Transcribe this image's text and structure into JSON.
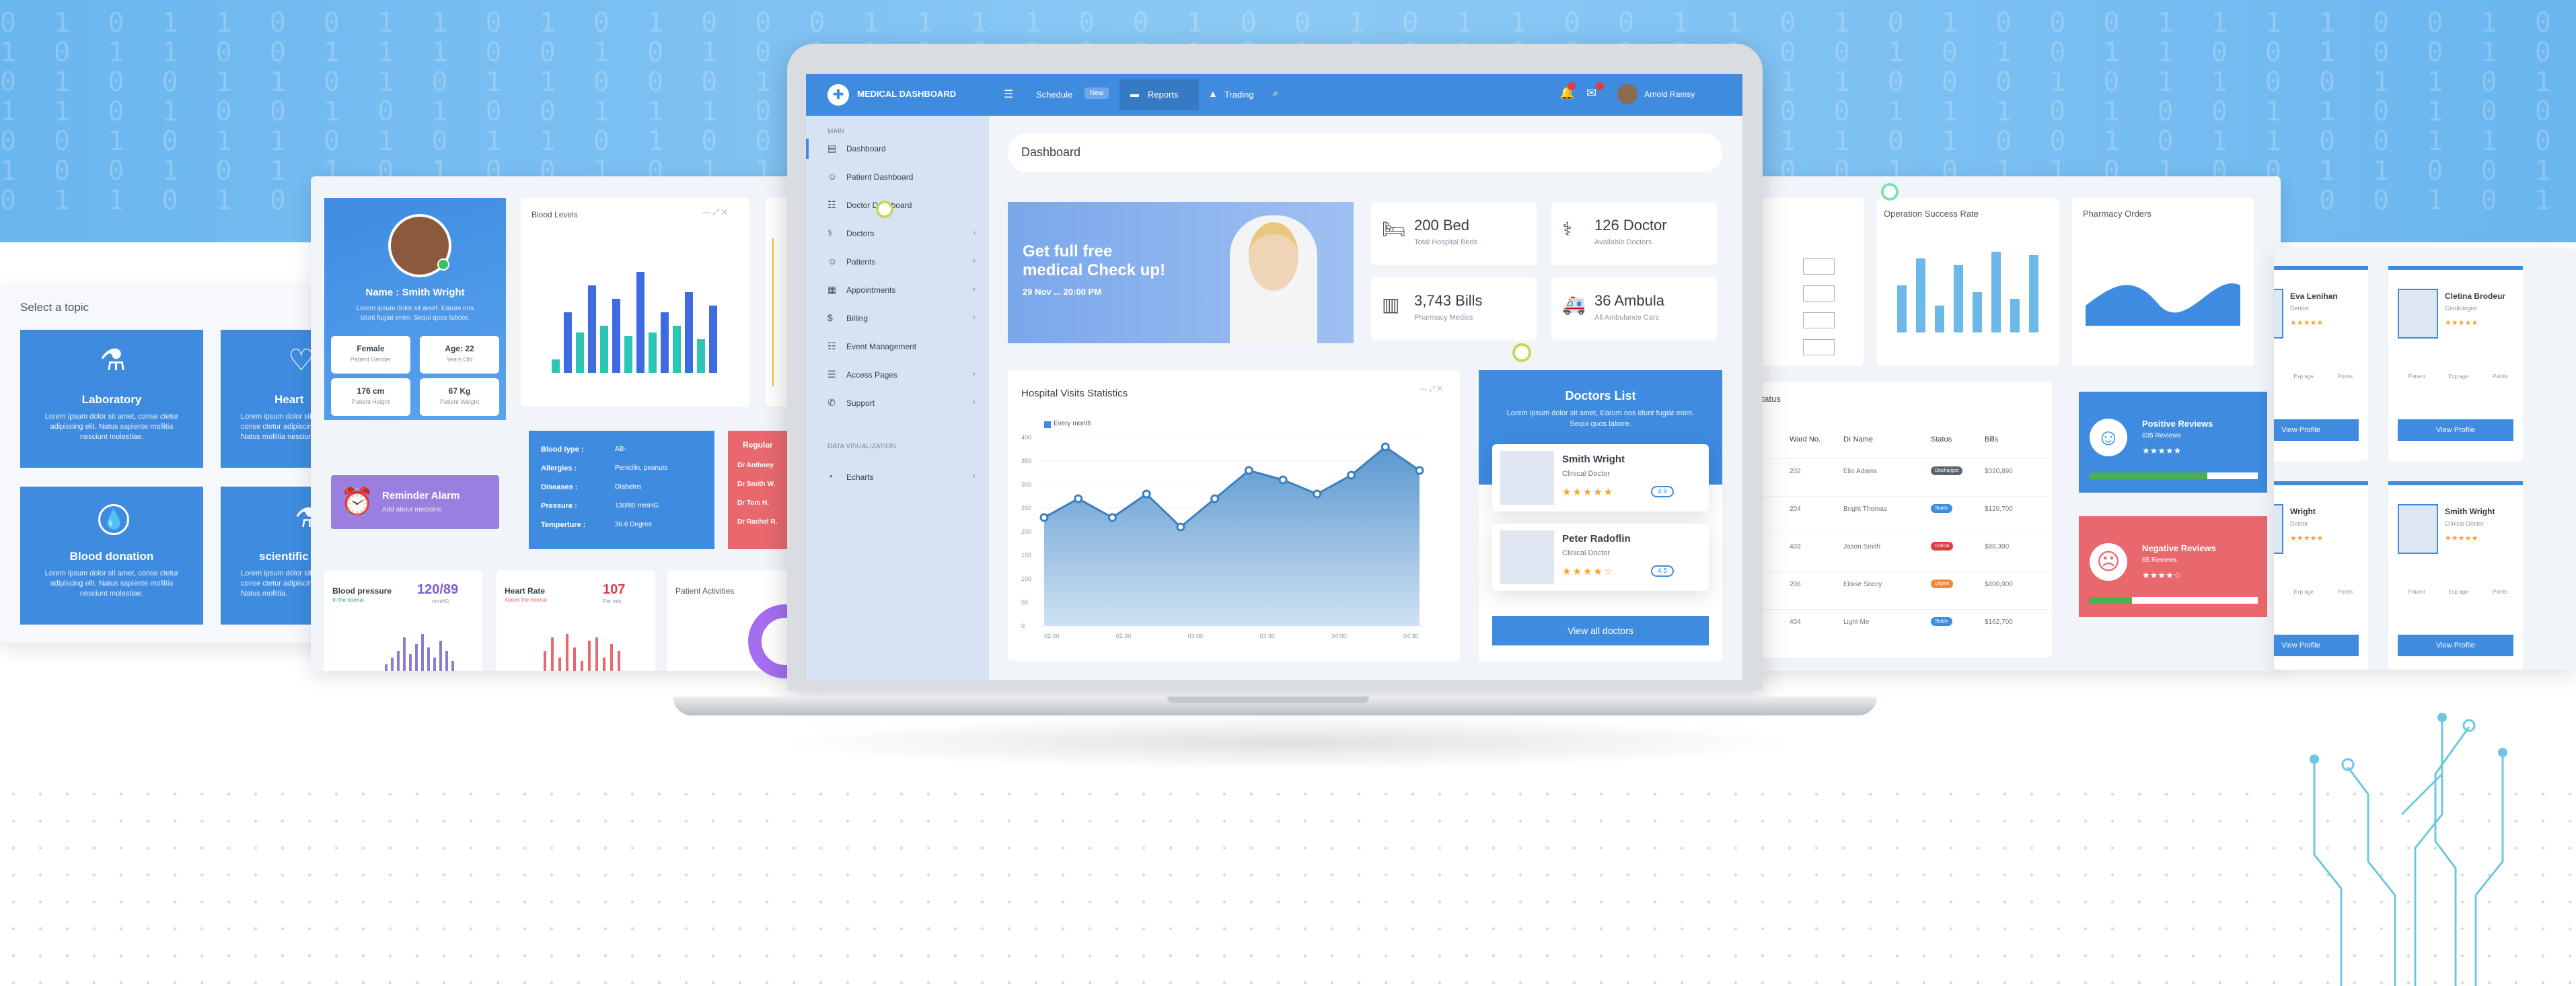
{
  "app": {
    "title": "MEDICAL DASHBOARD"
  },
  "topnav": {
    "schedule": "Schedule",
    "schedule_badge": "New",
    "reports": "Reports",
    "trading": "Trading",
    "user": "Arnold Ramsy"
  },
  "sidebar": {
    "section_main": "MAIN",
    "items": [
      {
        "label": "Dashboard"
      },
      {
        "label": "Patient Dashboard"
      },
      {
        "label": "Doctor Dashboard"
      },
      {
        "label": "Doctors"
      },
      {
        "label": "Patients"
      },
      {
        "label": "Appointments"
      },
      {
        "label": "Billing"
      },
      {
        "label": "Event Management"
      },
      {
        "label": "Access Pages"
      },
      {
        "label": "Support"
      }
    ],
    "section_data": "DATA VISUALIZATION",
    "data_items": [
      {
        "label": "Echarts"
      }
    ]
  },
  "page": {
    "title": "Dashboard"
  },
  "promo": {
    "title_1": "Get full free",
    "title_2": "medical Check up!",
    "date": "29 Nov ... 20:00 PM"
  },
  "stats": [
    {
      "value": "200 Bed",
      "label": "Total Hospital Beds",
      "icon": "bed-icon"
    },
    {
      "value": "126 Doctor",
      "label": "Available Doctors",
      "icon": "doctor-icon"
    },
    {
      "value": "3,743 Bills",
      "label": "Pharmacy Medics",
      "icon": "bill-icon"
    },
    {
      "value": "36 Ambula",
      "label": "All Ambulance Cars",
      "icon": "ambulance-icon"
    }
  ],
  "visits": {
    "title": "Hospital Visits Statistics",
    "legend": "Every month"
  },
  "chart_data": {
    "type": "area",
    "title": "Hospital Visits Statistics",
    "x": [
      "02:00",
      "02:30",
      "03:00",
      "03:30",
      "04:00",
      "04:30"
    ],
    "series": [
      {
        "name": "Every month",
        "values": [
          230,
          270,
          230,
          280,
          210,
          270,
          330,
          310,
          280,
          320,
          380,
          330
        ]
      }
    ],
    "y_ticks": [
      "400",
      "350",
      "300",
      "250",
      "200",
      "150",
      "100",
      "50",
      "0"
    ],
    "ylim": [
      0,
      400
    ]
  },
  "doctors_list": {
    "title": "Doctors List",
    "subtitle": "Lorem ipsum dolor sit amet, Earum nos idunt fugiat enim. Sequi quos labore.",
    "doctors": [
      {
        "name": "Smith Wright",
        "role": "Clinical Doctor",
        "stars": "★★★★★",
        "rating": "4.9"
      },
      {
        "name": "Peter Radoflin",
        "role": "Clinical Doctor",
        "stars": "★★★★☆",
        "rating": "4.5"
      }
    ],
    "button": "View all doctors"
  },
  "left_panel": {
    "topic": "Select a topic",
    "tiles": [
      {
        "title": "Laboratory",
        "text": "Lorem ipsum dolor sit amet, conse ctetur adipiscing elit. Natus sapiente mollitia nesciunt molestiae."
      },
      {
        "title": "Heart",
        "text": "Lorem ipsum dolor sit amet, conse ctetur adipiscing elit. Natus mollitia nesciunt."
      },
      {
        "title": "Blood donation",
        "text": "Lorem ipsum dolor sit amet, conse ctetur adipiscing elit. Natus sapiente mollitia nesciunt molestiae."
      },
      {
        "title": "scientific",
        "text": "Lorem ipsum dolor sit amet, conse ctetur adipiscing elit. Natus mollitia."
      }
    ]
  },
  "patient": {
    "name": "Name : Smith Wright",
    "desc": "Lorem ipsum dolor sit amet. Earum nos idunt fugiat enim. Sequi quos labore.",
    "gender": "Female",
    "gender_label": "Patient Gender",
    "age": "Age: 22",
    "age_label": "Years Old",
    "height": "176 cm",
    "height_label": "Patient Height",
    "weight": "67 Kg",
    "weight_label": "Patient Weight",
    "reminder": "Reminder Alarm",
    "reminder_sub": "Add about medicine",
    "blood_levels": "Blood Levels",
    "info_rows": [
      {
        "k": "Blood type :",
        "v": "AB-"
      },
      {
        "k": "Allergies :",
        "v": "Penicilin, peanuts"
      },
      {
        "k": "Diseases :",
        "v": "Diabetes"
      },
      {
        "k": "Pressure :",
        "v": "130/80 mmHG"
      },
      {
        "k": "Temperture :",
        "v": "36.6 Degree"
      }
    ],
    "regular": "Regular",
    "regular_rows": [
      "Dr Anthony",
      "Dr Smith W.",
      "Dr Tom H.",
      "Dr Rachel R."
    ],
    "bp_label": "Blood pressure",
    "bp_value": "120/89",
    "bp_sub": "In the normal",
    "bp_unit": "mmHG",
    "hr_label": "Heart Rate",
    "hr_value": "107",
    "hr_sub": "Above the normal",
    "hr_unit": "Per min",
    "activities": "Patient Activities"
  },
  "right_panel": {
    "op_title": "Operation Success Rate",
    "pharmacy_title": "Pharmacy Orders",
    "status_title": "Status",
    "table_headers": [
      "Ward No.",
      "Dr Name",
      "Status",
      "Bills"
    ],
    "rows": [
      {
        "ward": "202",
        "dr": "Elio Adams",
        "status": "Discharged",
        "bill": "$320,890"
      },
      {
        "ward": "204",
        "dr": "Bright Thomas",
        "status": "Stable",
        "bill": "$120,700"
      },
      {
        "ward": "403",
        "dr": "Jason Smith",
        "status": "Critical",
        "bill": "$88,300"
      },
      {
        "ward": "206",
        "dr": "Eloise Soccy",
        "status": "Urgent",
        "bill": "$400,000"
      },
      {
        "ward": "404",
        "dr": "Light Me",
        "status": "Stable",
        "bill": "$162,700"
      }
    ],
    "positive_title": "Positive Reviews",
    "positive_count": "835 Reviews",
    "negative_title": "Negative Reviews",
    "negative_count": "65 Reviews",
    "cards": [
      {
        "name": "Eva Lenihan",
        "role": "Dentist"
      },
      {
        "name": "Cletina Brodeur",
        "role": "Cardiologist"
      },
      {
        "name": "Wright",
        "role": "Doctor"
      },
      {
        "name": "Smith Wright",
        "role": "Clinical Doctor"
      }
    ],
    "view_profile": "View Profile",
    "stat_labels": [
      "Patient",
      "Exp age",
      "Points"
    ]
  }
}
